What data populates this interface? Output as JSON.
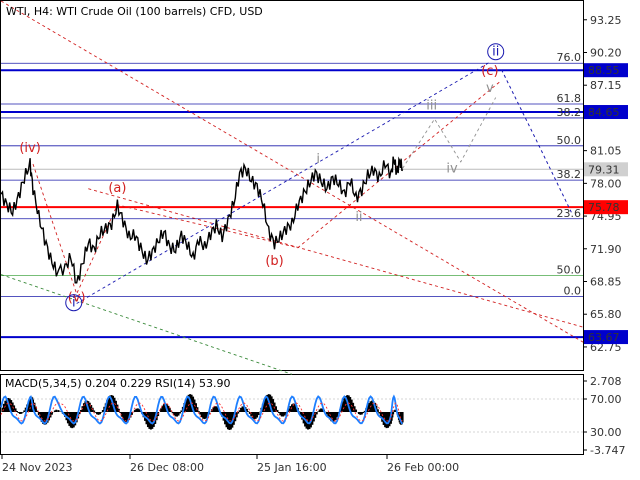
{
  "header": {
    "title": "WTI, H4:  WTI Crude Oil (100 barrels) CFD, USD"
  },
  "colors": {
    "price": "#000000",
    "blue_level": "#0000cc",
    "red_level": "#ff0000",
    "fib": "#1a1aaa",
    "fib_green": "#4aa84a",
    "wave_red": "#d22020",
    "wave_blue": "#1a1ab0",
    "wave_grey": "#909090",
    "current_price_bg": "#d0d0d0",
    "level_bg_blue": "#0000cc",
    "level_bg_red": "#ff0000"
  },
  "chart_data": {
    "type": "line",
    "title": "WTI, H4:  WTI Crude Oil (100 barrels) CFD, USD",
    "ylim": [
      60.6,
      95.0
    ],
    "y_ticks": [
      "93.25",
      "90.20",
      "87.15",
      "81.05",
      "78.00",
      "74.95",
      "71.90",
      "68.85",
      "65.80",
      "62.75"
    ],
    "x_ticks": [
      "24 Nov 2023",
      "26 Dec 08:00",
      "25 Jan 16:00",
      "26 Feb 00:00"
    ],
    "current_price": "79.31",
    "levels": [
      {
        "value": 88.55,
        "label": "88.55",
        "color": "blue"
      },
      {
        "value": 84.65,
        "label": "84.65",
        "color": "blue"
      },
      {
        "value": 75.78,
        "label": "75.78",
        "color": "red"
      },
      {
        "value": 63.67,
        "label": "63.67",
        "color": "blue"
      }
    ],
    "fib_levels": [
      {
        "value": 89.2,
        "label": "76.0"
      },
      {
        "value": 85.4,
        "label": "61.8"
      },
      {
        "value": 84.1,
        "label": "38.2"
      },
      {
        "value": 81.5,
        "label": "50.0"
      },
      {
        "value": 78.3,
        "label": "38.2"
      },
      {
        "value": 74.7,
        "label": "23.6"
      },
      {
        "value": 69.4,
        "label": "50.0"
      },
      {
        "value": 67.45,
        "label": "0.0"
      }
    ],
    "wave_labels": [
      {
        "text": "(iv)",
        "x": 0.05,
        "y": 80.9,
        "color": "red"
      },
      {
        "text": "(a)",
        "x": 0.2,
        "y": 77.2,
        "color": "red"
      },
      {
        "text": "(b)",
        "x": 0.47,
        "y": 70.4,
        "color": "red"
      },
      {
        "text": "(c)",
        "x": 0.84,
        "y": 88.1,
        "color": "red"
      },
      {
        "text": "(v)",
        "x": 0.13,
        "y": 67.0,
        "color": "red"
      },
      {
        "text": "i",
        "x": 0.125,
        "y": 66.5,
        "color": "blue",
        "circled": true
      },
      {
        "text": "ii",
        "x": 0.85,
        "y": 89.9,
        "color": "blue",
        "circled": true
      },
      {
        "text": "i",
        "x": 0.545,
        "y": 79.9,
        "color": "grey"
      },
      {
        "text": "ii",
        "x": 0.615,
        "y": 74.5,
        "color": "grey"
      },
      {
        "text": "iii",
        "x": 0.74,
        "y": 84.9,
        "color": "grey"
      },
      {
        "text": "iv",
        "x": 0.775,
        "y": 79.0,
        "color": "grey"
      },
      {
        "text": "v",
        "x": 0.84,
        "y": 86.5,
        "color": "grey"
      }
    ],
    "price_points": [
      [
        0.0,
        77.0
      ],
      [
        0.01,
        76.0
      ],
      [
        0.02,
        75.3
      ],
      [
        0.03,
        76.8
      ],
      [
        0.04,
        78.5
      ],
      [
        0.05,
        79.8
      ],
      [
        0.055,
        77.5
      ],
      [
        0.065,
        74.9
      ],
      [
        0.075,
        72.8
      ],
      [
        0.085,
        71.0
      ],
      [
        0.095,
        69.8
      ],
      [
        0.11,
        70.1
      ],
      [
        0.12,
        71.2
      ],
      [
        0.13,
        68.6
      ],
      [
        0.14,
        70.5
      ],
      [
        0.15,
        72.5
      ],
      [
        0.16,
        71.8
      ],
      [
        0.17,
        73.3
      ],
      [
        0.18,
        73.8
      ],
      [
        0.19,
        74.2
      ],
      [
        0.2,
        75.9
      ],
      [
        0.21,
        74.5
      ],
      [
        0.22,
        73.0
      ],
      [
        0.23,
        73.2
      ],
      [
        0.24,
        72.0
      ],
      [
        0.25,
        70.8
      ],
      [
        0.26,
        71.6
      ],
      [
        0.27,
        72.6
      ],
      [
        0.28,
        73.5
      ],
      [
        0.29,
        72.0
      ],
      [
        0.3,
        71.8
      ],
      [
        0.31,
        73.2
      ],
      [
        0.32,
        72.3
      ],
      [
        0.33,
        71.0
      ],
      [
        0.34,
        72.8
      ],
      [
        0.35,
        72.0
      ],
      [
        0.36,
        73.3
      ],
      [
        0.37,
        74.1
      ],
      [
        0.38,
        73.0
      ],
      [
        0.39,
        74.5
      ],
      [
        0.4,
        76.2
      ],
      [
        0.41,
        78.9
      ],
      [
        0.42,
        79.4
      ],
      [
        0.43,
        78.3
      ],
      [
        0.44,
        77.7
      ],
      [
        0.45,
        76.2
      ],
      [
        0.46,
        73.5
      ],
      [
        0.47,
        72.4
      ],
      [
        0.48,
        73.0
      ],
      [
        0.49,
        73.8
      ],
      [
        0.5,
        74.2
      ],
      [
        0.51,
        76.0
      ],
      [
        0.52,
        77.0
      ],
      [
        0.53,
        78.0
      ],
      [
        0.54,
        79.0
      ],
      [
        0.55,
        78.2
      ],
      [
        0.56,
        77.5
      ],
      [
        0.57,
        78.5
      ],
      [
        0.58,
        78.0
      ],
      [
        0.59,
        77.0
      ],
      [
        0.6,
        78.3
      ],
      [
        0.61,
        76.6
      ],
      [
        0.62,
        77.4
      ],
      [
        0.63,
        78.7
      ],
      [
        0.64,
        79.3
      ],
      [
        0.65,
        78.5
      ],
      [
        0.66,
        79.9
      ],
      [
        0.67,
        78.8
      ],
      [
        0.675,
        80.3
      ],
      [
        0.68,
        79.0
      ],
      [
        0.685,
        80.1
      ],
      [
        0.69,
        79.31
      ]
    ],
    "macd": {
      "label": "MACD(5,34,5) 0.204 0.229 RSI(14) 53.90",
      "ticks": [
        "2.708",
        "70.00",
        "30.00",
        "-3.747"
      ]
    }
  }
}
